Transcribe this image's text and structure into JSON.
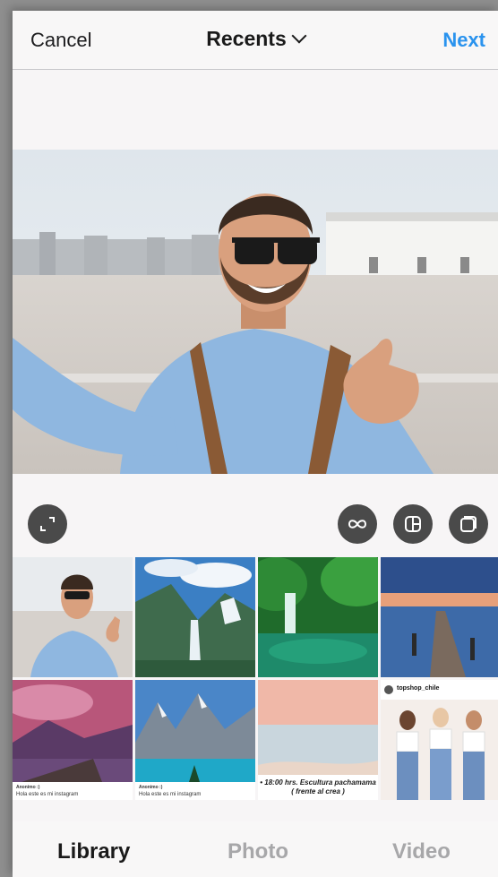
{
  "header": {
    "cancel_label": "Cancel",
    "title": "Recents",
    "next_label": "Next",
    "accent_color": "#2a93ee"
  },
  "tools": {
    "expand_icon": "expand-corners-icon",
    "boomerang_icon": "infinity-icon",
    "layout_icon": "layout-grid-icon",
    "multi_select_icon": "stacked-squares-icon"
  },
  "grid": {
    "captions": {
      "cell5_user": "Anonimo :)",
      "cell5_text": "Hola este es mi instagram",
      "cell6_user": "Anonimo :)",
      "cell6_text": "Hola este es mi instagram",
      "cell7_poster": "• 18:00 hrs. Escultura pachamama ( frente al crea )",
      "cell8_user": "topshop_chile"
    }
  },
  "tabs": {
    "library": "Library",
    "photo": "Photo",
    "video": "Video"
  }
}
